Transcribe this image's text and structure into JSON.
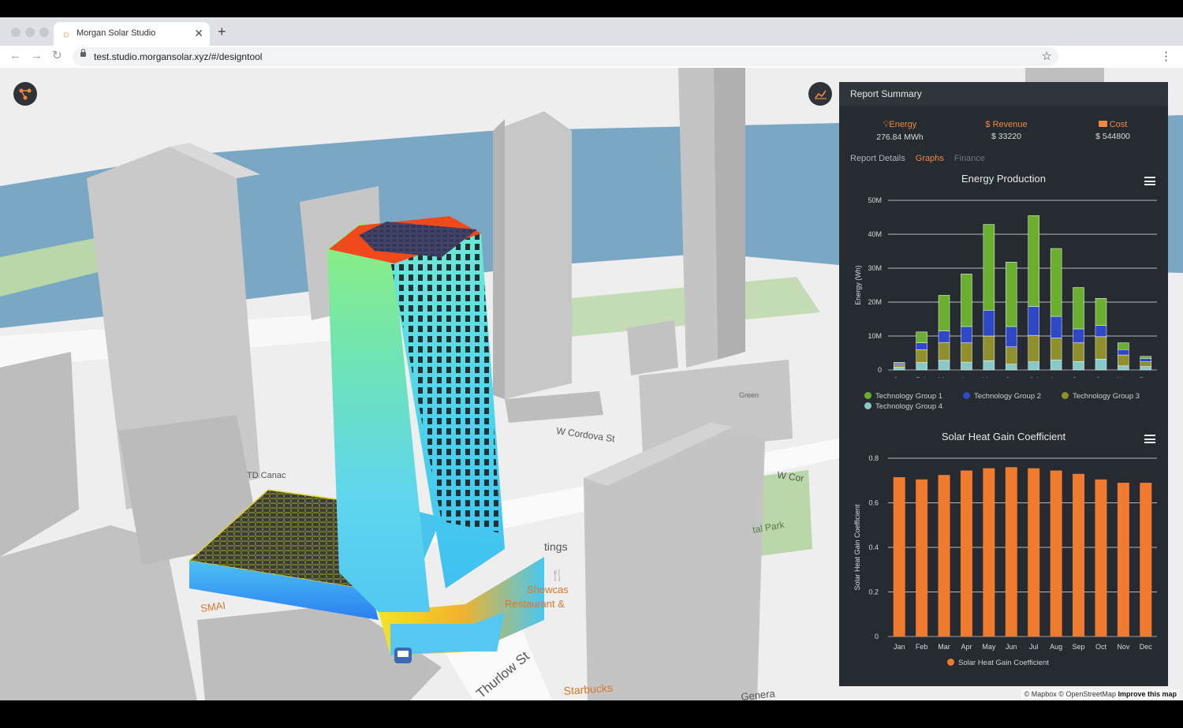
{
  "browser": {
    "tab_title": "Morgan Solar Studio",
    "tab_icon": "sun-icon",
    "url": "test.studio.morgansolar.xyz/#/designtool",
    "new_tab": "+",
    "close": "✕"
  },
  "map": {
    "attribution_prefix": "© Mapbox © OpenStreetMap",
    "attribution_link": "Improve this map",
    "labels": {
      "cordova": "W Cordova St",
      "cordova2": "W Cor",
      "thurlow": "Thurlow St",
      "td": "TD Canac",
      "showcase": "Showcas",
      "restaurant": "Restaurant &",
      "starbucks": "Starbucks",
      "tings": "tings",
      "park": "tal Park",
      "sma": "SMAI",
      "genera": "Genera",
      "green": "Green"
    }
  },
  "report": {
    "title": "Report Summary",
    "energy_label": "Energy",
    "energy_value": "276.84 MWh",
    "revenue_label": "$ Revenue",
    "revenue_value": "$ 33220",
    "cost_label": "Cost",
    "cost_value": "$ 544800",
    "details_label": "Report Details",
    "tab_graphs": "Graphs",
    "tab_finance": "Finance"
  },
  "colors": {
    "accent": "#f0883e",
    "panel_bg": "#262b31",
    "group1": "#6aaf2e",
    "group2": "#2f48c6",
    "group3": "#8f8f2c",
    "group4": "#86c9c6",
    "shgc": "#f07a2e"
  },
  "chart_data": [
    {
      "type": "bar",
      "stacked": true,
      "title": "Energy Production",
      "ylabel": "Energy (Wh)",
      "ylim": [
        0,
        50000000
      ],
      "yticks": [
        "0",
        "10M",
        "20M",
        "30M",
        "40M",
        "50M"
      ],
      "categories": [
        "Jan",
        "Feb",
        "Mar",
        "Apr",
        "May",
        "Jun",
        "Jul",
        "Aug",
        "Sep",
        "Oct",
        "Nov",
        "Dec"
      ],
      "series": [
        {
          "name": "Technology Group 4",
          "values": [
            800000,
            2200000,
            2800000,
            2300000,
            2700000,
            1700000,
            2400000,
            2900000,
            2500000,
            3200000,
            1200000,
            1000000
          ]
        },
        {
          "name": "Technology Group 3",
          "values": [
            700000,
            3800000,
            5300000,
            5700000,
            7300000,
            5100000,
            7800000,
            6500000,
            5500000,
            6600000,
            3200000,
            1400000
          ]
        },
        {
          "name": "Technology Group 2",
          "values": [
            500000,
            2000000,
            3400000,
            4800000,
            7600000,
            6000000,
            8500000,
            6400000,
            4100000,
            3300000,
            1600000,
            1000000
          ]
        },
        {
          "name": "Technology Group 1",
          "values": [
            200000,
            3200000,
            10500000,
            15500000,
            25300000,
            19000000,
            26800000,
            20000000,
            12200000,
            8000000,
            2000000,
            600000
          ]
        }
      ],
      "legend": [
        "Technology Group 1",
        "Technology Group 2",
        "Technology Group 3",
        "Technology Group 4"
      ]
    },
    {
      "type": "bar",
      "title": "Solar Heat Gain Coefficient",
      "ylabel": "Solar Heat Gain Coefficient",
      "ylim": [
        0,
        0.8
      ],
      "yticks": [
        "0",
        "0.2",
        "0.4",
        "0.6",
        "0.8"
      ],
      "categories": [
        "Jan",
        "Feb",
        "Mar",
        "Apr",
        "May",
        "Jun",
        "Jul",
        "Aug",
        "Sep",
        "Oct",
        "Nov",
        "Dec"
      ],
      "series": [
        {
          "name": "Solar Heat Gain Coefficient",
          "values": [
            0.715,
            0.705,
            0.725,
            0.745,
            0.755,
            0.76,
            0.755,
            0.745,
            0.73,
            0.705,
            0.69,
            0.69
          ]
        }
      ]
    }
  ]
}
